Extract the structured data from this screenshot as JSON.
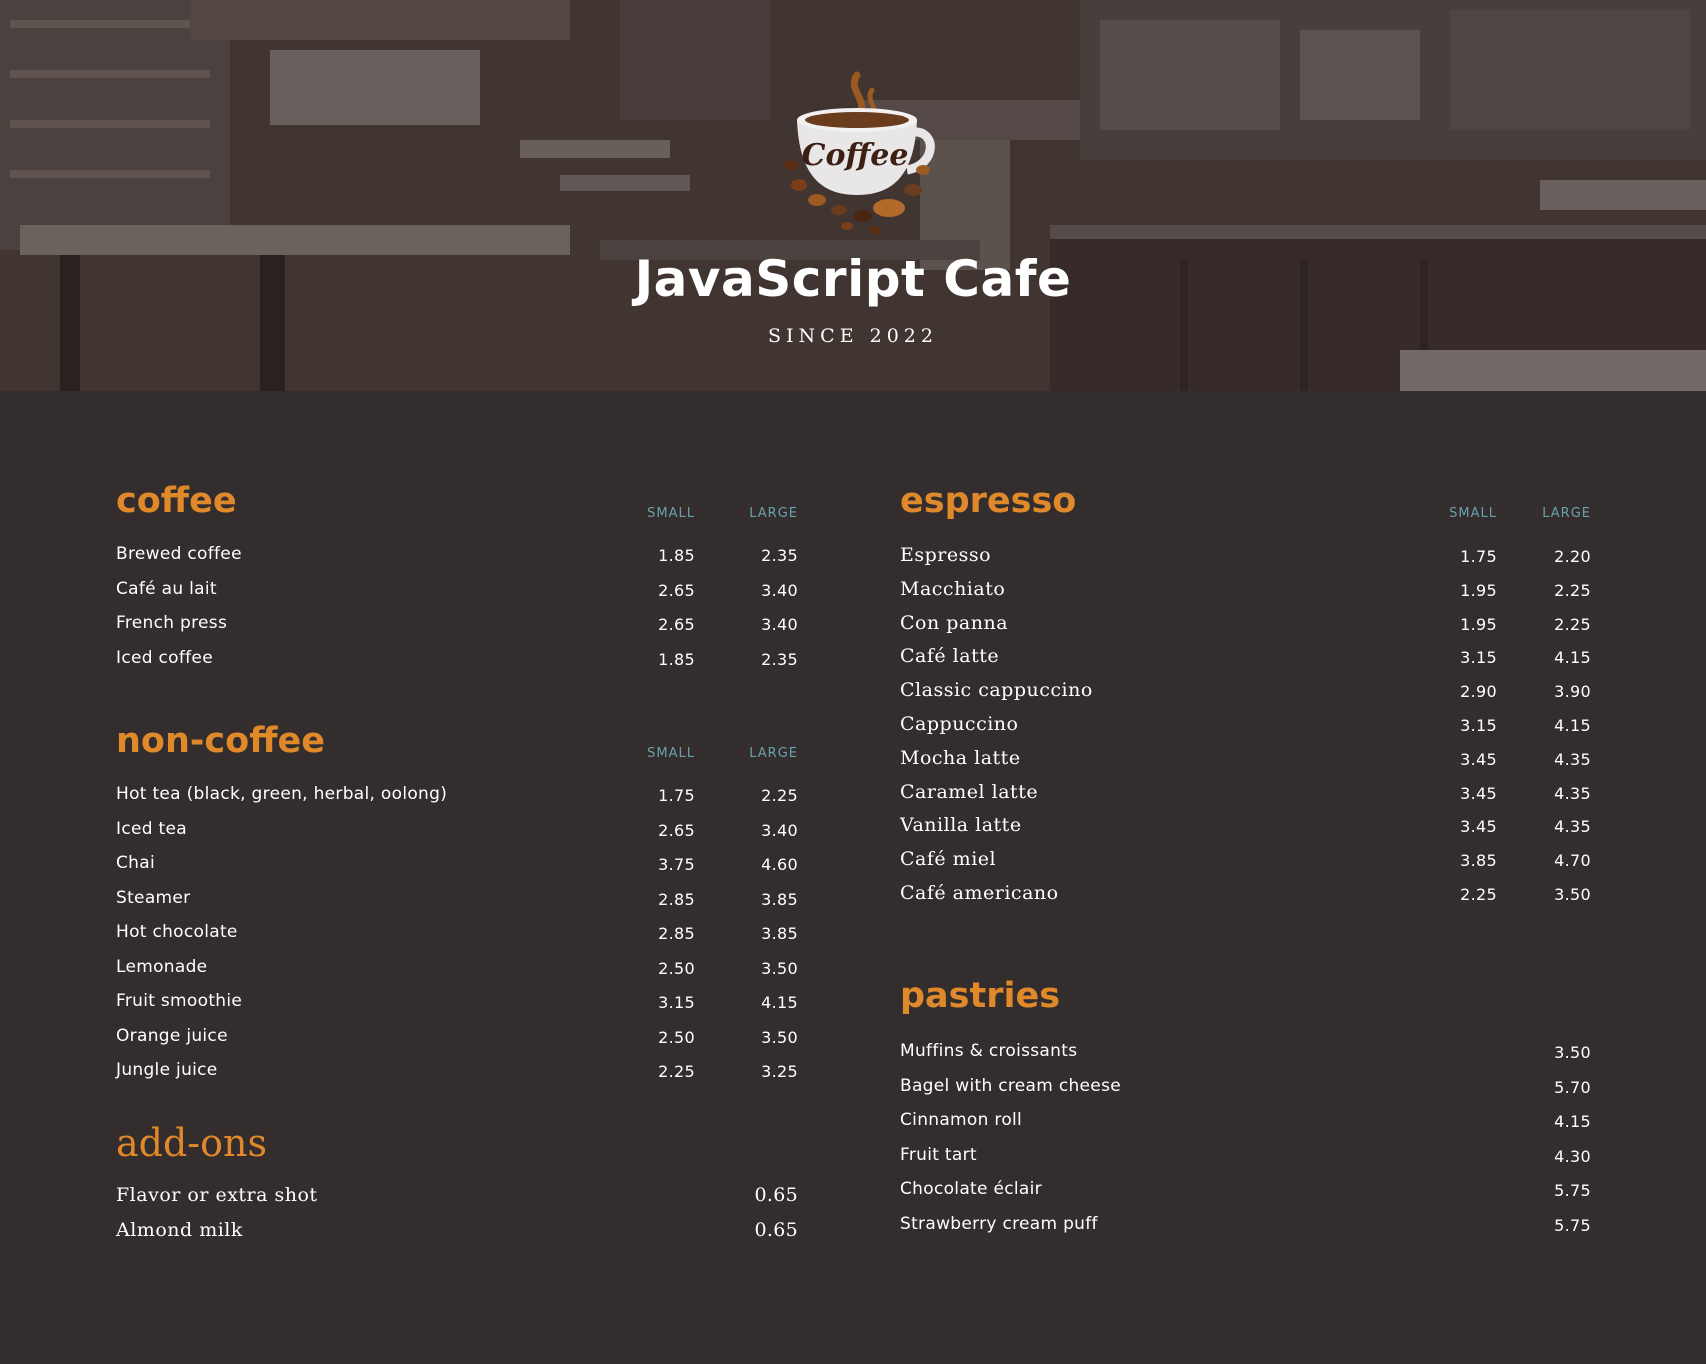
{
  "header": {
    "logo_text": "Coffee",
    "title": "JavaScript Cafe",
    "subtitle": "SINCE 2022"
  },
  "columns": {
    "small": "SMALL",
    "large": "LARGE"
  },
  "coffee": {
    "title": "coffee",
    "items": [
      {
        "name": "Brewed coffee",
        "small": "1.85",
        "large": "2.35"
      },
      {
        "name": "Café au lait",
        "small": "2.65",
        "large": "3.40"
      },
      {
        "name": "French press",
        "small": "2.65",
        "large": "3.40"
      },
      {
        "name": "Iced coffee",
        "small": "1.85",
        "large": "2.35"
      }
    ]
  },
  "non_coffee": {
    "title": "non-coffee",
    "items": [
      {
        "name": "Hot tea (black, green, herbal, oolong)",
        "small": "1.75",
        "large": "2.25"
      },
      {
        "name": "Iced tea",
        "small": "2.65",
        "large": "3.40"
      },
      {
        "name": "Chai",
        "small": "3.75",
        "large": "4.60"
      },
      {
        "name": "Steamer",
        "small": "2.85",
        "large": "3.85"
      },
      {
        "name": "Hot chocolate",
        "small": "2.85",
        "large": "3.85"
      },
      {
        "name": "Lemonade",
        "small": "2.50",
        "large": "3.50"
      },
      {
        "name": "Fruit smoothie",
        "small": "3.15",
        "large": "4.15"
      },
      {
        "name": "Orange juice",
        "small": "2.50",
        "large": "3.50"
      },
      {
        "name": "Jungle juice",
        "small": "2.25",
        "large": "3.25"
      }
    ]
  },
  "add_ons": {
    "title": "add-ons",
    "items": [
      {
        "name": "Flavor or extra shot",
        "price": "0.65"
      },
      {
        "name": "Almond milk",
        "price": "0.65"
      }
    ]
  },
  "espresso": {
    "title": "espresso",
    "items": [
      {
        "name": "Espresso",
        "small": "1.75",
        "large": "2.20"
      },
      {
        "name": "Macchiato",
        "small": "1.95",
        "large": "2.25"
      },
      {
        "name": "Con panna",
        "small": "1.95",
        "large": "2.25"
      },
      {
        "name": "Café latte",
        "small": "3.15",
        "large": "4.15"
      },
      {
        "name": "Classic cappuccino",
        "small": "2.90",
        "large": "3.90"
      },
      {
        "name": "Cappuccino",
        "small": "3.15",
        "large": "4.15"
      },
      {
        "name": "Mocha latte",
        "small": "3.45",
        "large": "4.35"
      },
      {
        "name": "Caramel latte",
        "small": "3.45",
        "large": "4.35"
      },
      {
        "name": "Vanilla latte",
        "small": "3.45",
        "large": "4.35"
      },
      {
        "name": "Café miel",
        "small": "3.85",
        "large": "4.70"
      },
      {
        "name": "Café americano",
        "small": "2.25",
        "large": "3.50"
      }
    ]
  },
  "pastries": {
    "title": "pastries",
    "items": [
      {
        "name": "Muffins & croissants",
        "price": "3.50"
      },
      {
        "name": "Bagel with cream cheese",
        "price": "5.70"
      },
      {
        "name": "Cinnamon roll",
        "price": "4.15"
      },
      {
        "name": "Fruit tart",
        "price": "4.30"
      },
      {
        "name": "Chocolate éclair",
        "price": "5.75"
      },
      {
        "name": "Strawberry cream puff",
        "price": "5.75"
      }
    ]
  },
  "colors": {
    "background": "#332e2d",
    "accent": "#e0892b",
    "size_label": "#6aa0ab",
    "text": "#ffffff"
  }
}
